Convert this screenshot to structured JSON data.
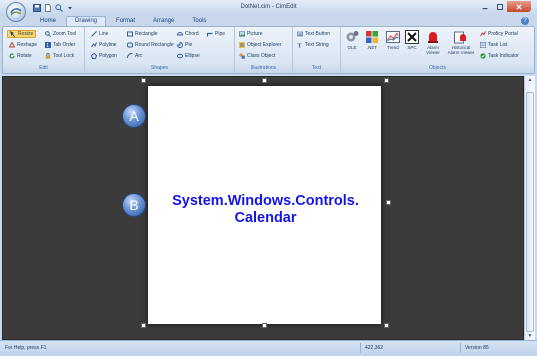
{
  "window": {
    "title": "DotNet.cim - CimEdit"
  },
  "tabs": [
    "Home",
    "Drawing",
    "Format",
    "Arrange",
    "Tools"
  ],
  "active_tab": "Drawing",
  "ribbon": {
    "edit": {
      "label": "Edit",
      "resize": "Resize",
      "zoom_tool": "Zoom Tool",
      "reshape": "Reshape",
      "tab_order": "Tab Order",
      "rotate": "Rotate",
      "tool_lock": "Tool Lock"
    },
    "shapes": {
      "label": "Shapes",
      "line": "Line",
      "rectangle": "Rectangle",
      "chord": "Chord",
      "pipe": "Pipe",
      "polyline": "Polyline",
      "round_rectangle": "Round Rectangle",
      "pie": "Pie",
      "polygon": "Polygon",
      "arc": "Arc",
      "ellipse": "Ellipse"
    },
    "illustrations": {
      "label": "Illustrations",
      "picture": "Picture",
      "object_explorer": "Object Explorer",
      "class_object": "Class Object"
    },
    "text": {
      "label": "Text",
      "text_button": "Text Button",
      "text_string": "Text String"
    },
    "objects": {
      "label": "Objects",
      "ocx": "OLE",
      "net": ".NET",
      "trend": "Trend",
      "spc": "SPC",
      "alarm_viewer": "Alarm Viewer",
      "historical_alarm_viewer": "Historical Alarm Viewer",
      "proficy_portal": "Proficy Portal",
      "task_list": "Task List",
      "task_indicator": "Task Indicator"
    }
  },
  "canvas": {
    "callout_a": "A",
    "callout_b": "B",
    "control_text": "System.Windows.Controls. Calendar"
  },
  "status": {
    "help": "For Help, press F1",
    "coords": "422,362",
    "version": "Version 85"
  },
  "colors": {
    "control_text": "#1515e8",
    "workspace": "#3b3b3b",
    "ribbon": "#dfe9f5"
  }
}
